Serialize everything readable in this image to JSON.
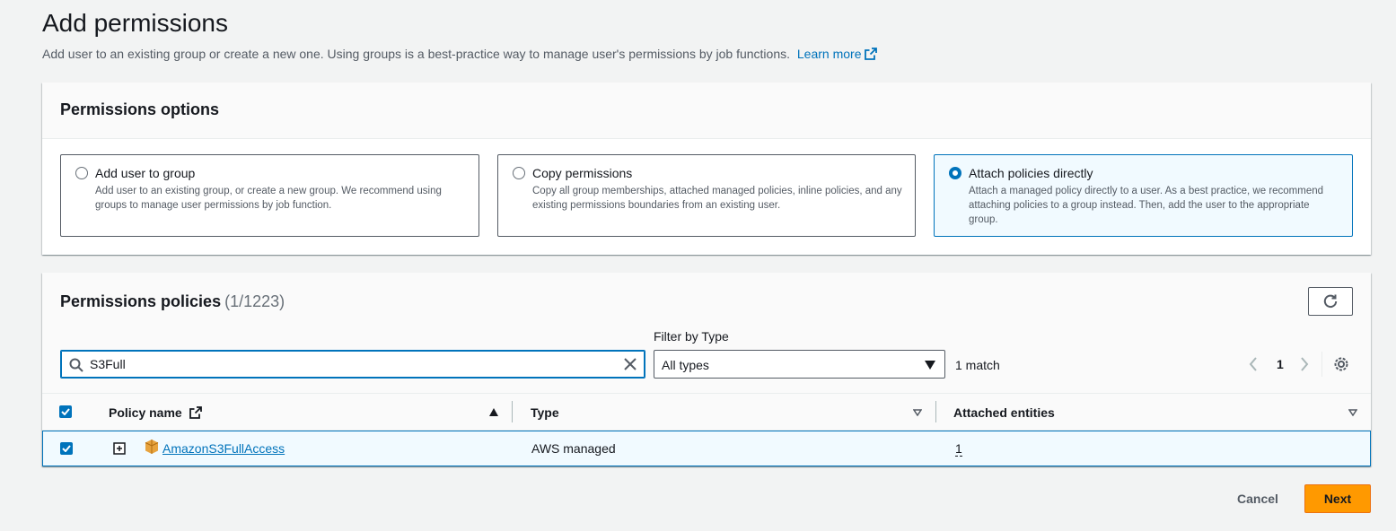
{
  "header": {
    "title": "Add permissions",
    "description": "Add user to an existing group or create a new one. Using groups is a best-practice way to manage user's permissions by job functions.",
    "learn_more": "Learn more"
  },
  "options": {
    "title": "Permissions options",
    "tiles": [
      {
        "label": "Add user to group",
        "description": "Add user to an existing group, or create a new group. We recommend using groups to manage user permissions by job function.",
        "selected": false
      },
      {
        "label": "Copy permissions",
        "description": "Copy all group memberships, attached managed policies, inline policies, and any existing permissions boundaries from an existing user.",
        "selected": false
      },
      {
        "label": "Attach policies directly",
        "description": "Attach a managed policy directly to a user. As a best practice, we recommend attaching policies to a group instead. Then, add the user to the appropriate group.",
        "selected": true
      }
    ]
  },
  "policies": {
    "title": "Permissions policies",
    "count": "(1/1223)",
    "search_value": "S3Full",
    "filter_label": "Filter by Type",
    "filter_value": "All types",
    "match_count": "1 match",
    "page": "1",
    "columns": {
      "policy_name": "Policy name",
      "type": "Type",
      "attached_entities": "Attached entities"
    },
    "rows": [
      {
        "name": "AmazonS3FullAccess",
        "type": "AWS managed",
        "attached_entities": "1",
        "checked": true
      }
    ]
  },
  "footer": {
    "cancel_label": "Cancel",
    "next_label": "Next"
  },
  "colors": {
    "accent": "#0073bb",
    "primary_button": "#ff9900",
    "s3_icon": "#e7a33e"
  }
}
